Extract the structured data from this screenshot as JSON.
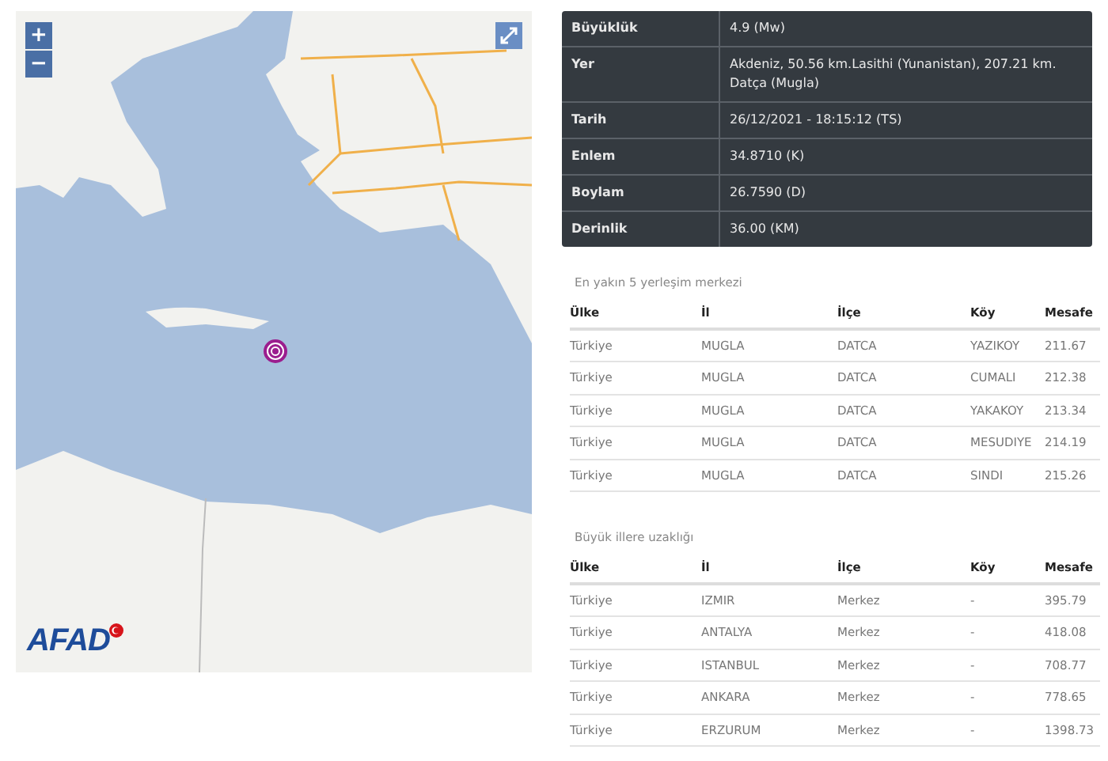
{
  "map": {
    "zoom_in": "+",
    "zoom_out": "−",
    "logo": "AFAD"
  },
  "details": [
    {
      "label": "Büyüklük",
      "value": "4.9 (Mw)"
    },
    {
      "label": "Yer",
      "value": "Akdeniz, 50.56 km.Lasithi (Yunanistan), 207.21 km. Datça (Mugla)"
    },
    {
      "label": "Tarih",
      "value": "26/12/2021 - 18:15:12 (TS)"
    },
    {
      "label": "Enlem",
      "value": "34.8710 (K)"
    },
    {
      "label": "Boylam",
      "value": "26.7590 (D)"
    },
    {
      "label": "Derinlik",
      "value": "36.00 (KM)"
    }
  ],
  "tables": [
    {
      "caption": "En yakın 5 yerleşim merkezi",
      "columns": [
        "Ülke",
        "İl",
        "İlçe",
        "Köy",
        "Mesafe"
      ],
      "rows": [
        [
          "Türkiye",
          "MUGLA",
          "DATCA",
          "YAZIKOY",
          "211.67"
        ],
        [
          "Türkiye",
          "MUGLA",
          "DATCA",
          "CUMALI",
          "212.38"
        ],
        [
          "Türkiye",
          "MUGLA",
          "DATCA",
          "YAKAKOY",
          "213.34"
        ],
        [
          "Türkiye",
          "MUGLA",
          "DATCA",
          "MESUDIYE",
          "214.19"
        ],
        [
          "Türkiye",
          "MUGLA",
          "DATCA",
          "SINDI",
          "215.26"
        ]
      ]
    },
    {
      "caption": "Büyük illere uzaklığı",
      "columns": [
        "Ülke",
        "İl",
        "İlçe",
        "Köy",
        "Mesafe"
      ],
      "rows": [
        [
          "Türkiye",
          "IZMIR",
          "Merkez",
          "-",
          "395.79"
        ],
        [
          "Türkiye",
          "ANTALYA",
          "Merkez",
          "-",
          "418.08"
        ],
        [
          "Türkiye",
          "ISTANBUL",
          "Merkez",
          "-",
          "708.77"
        ],
        [
          "Türkiye",
          "ANKARA",
          "Merkez",
          "-",
          "778.65"
        ],
        [
          "Türkiye",
          "ERZURUM",
          "Merkez",
          "-",
          "1398.73"
        ]
      ]
    }
  ]
}
